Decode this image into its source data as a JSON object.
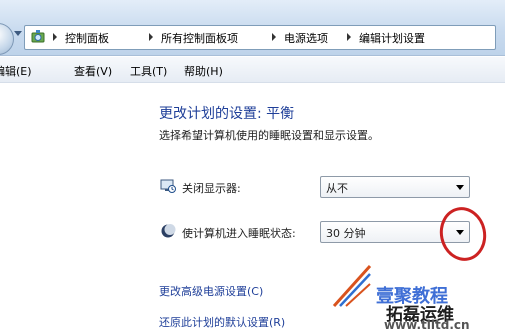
{
  "breadcrumb": [
    "控制面板",
    "所有控制面板项",
    "电源选项",
    "编辑计划设置"
  ],
  "menu": [
    "编辑(E)",
    "查看(V)",
    "工具(T)",
    "帮助(H)"
  ],
  "page": {
    "title": "更改计划的设置: 平衡",
    "subtitle": "选择希望计算机使用的睡眠设置和显示设置。"
  },
  "settings": [
    {
      "label": "关闭显示器:",
      "value": "从不",
      "icon": "monitor-icon"
    },
    {
      "label": "使计算机进入睡眠状态:",
      "value": "30 分钟",
      "icon": "moon-icon"
    }
  ],
  "links": [
    "更改高级电源设置(C)",
    "还原此计划的默认设置(R)"
  ],
  "watermark": {
    "line1": "壹聚教程",
    "line2": "拓磊运维",
    "url": "www.tlltd.cn"
  },
  "colors": {
    "link": "#1f3f99",
    "highlight": "#cc2222"
  }
}
